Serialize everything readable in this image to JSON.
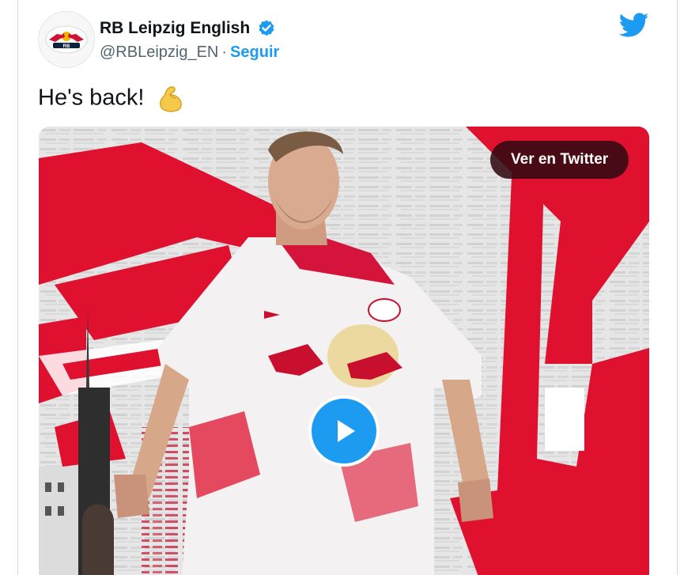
{
  "tweet": {
    "author": {
      "display_name": "RB Leipzig English",
      "handle": "@RBLeipzig_EN",
      "separator": "·",
      "follow_label": "Seguir",
      "verified": true,
      "avatar_icon": "rb-leipzig-logo-icon"
    },
    "text": "He's back!",
    "emoji_icon": "flexed-biceps-icon",
    "platform_icon": "twitter-bird-icon",
    "media": {
      "type": "video",
      "view_on_label": "Ver en Twitter",
      "play_icon": "play-icon"
    }
  },
  "colors": {
    "accent": "#1d9bf0",
    "brand_red": "#e0102f",
    "text_primary": "#0f1419",
    "text_secondary": "#536471"
  }
}
